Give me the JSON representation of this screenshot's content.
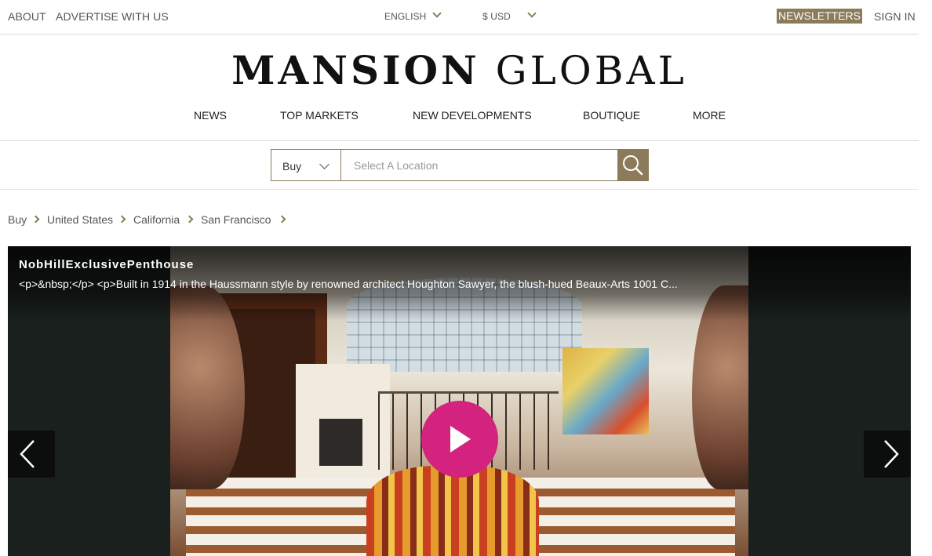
{
  "topbar": {
    "about": "ABOUT",
    "advertise": "ADVERTISE WITH US",
    "language": "ENGLISH",
    "currency": "$ USD",
    "newsletters": "NEWSLETTERS",
    "sign_in": "SIGN IN"
  },
  "logo": {
    "part1": "MANSION",
    "part2": "GLOBAL"
  },
  "nav": {
    "items": [
      "NEWS",
      "TOP MARKETS",
      "NEW DEVELOPMENTS",
      "BOUTIQUE",
      "MORE"
    ]
  },
  "search": {
    "mode": "Buy",
    "placeholder": "Select A Location",
    "icon": "search-icon"
  },
  "breadcrumb": [
    "Buy",
    "United States",
    "California",
    "San Francisco"
  ],
  "hero": {
    "title": "NobHillExclusivePenthouse",
    "description": "<p>&nbsp;</p> <p>Built in 1914 in the Haussmann style by renowned architect Houghton Sawyer, the blush-hued Beaux-Arts 1001 C...",
    "play_icon": "play-icon",
    "prev_icon": "chevron-left-icon",
    "next_icon": "chevron-right-icon",
    "accent_color": "#d4237e"
  },
  "colors": {
    "brand_gold": "#8b7b5a",
    "play_pink": "#d4237e"
  }
}
